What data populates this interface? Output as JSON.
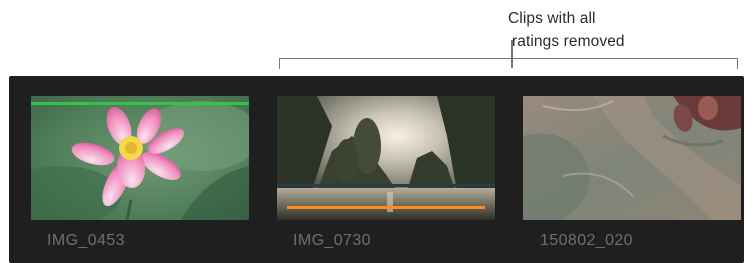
{
  "callout": {
    "line1": "Clips with all",
    "line2": "ratings removed"
  },
  "colors": {
    "favorite_bar": "#35c24a",
    "rejected_bar": "#ff8a1e",
    "browser_bg": "#1f1f1f",
    "clip_name": "#6f6f6f"
  },
  "clips": [
    {
      "name": "IMG_0453",
      "rating": "favorite"
    },
    {
      "name": "IMG_0730",
      "rating": "rejected"
    },
    {
      "name": "150802_020",
      "rating": "none"
    }
  ]
}
